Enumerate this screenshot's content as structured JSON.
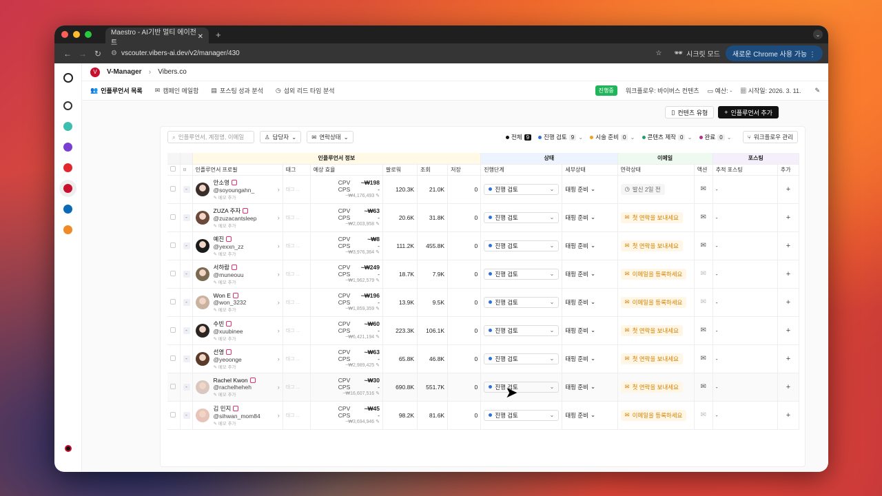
{
  "browser": {
    "tab_title": "Maestro - AI기반 멀티 에이전트",
    "url": "vscouter.vibers-ai.dev/v2/manager/430",
    "incognito": "시크릿 모드",
    "chrome_update": "새로운 Chrome 사용 가능"
  },
  "breadcrumb": {
    "app": "V-Manager",
    "org": "Vibers.co"
  },
  "subnav": {
    "tabs": [
      "인플루언서 목록",
      "캠페인 메일함",
      "포스팅 성과 분석",
      "섭외 리드 타임 분석"
    ],
    "status_badge": "진행중",
    "workflow": "워크플로우: 바이버스 컨텐츠",
    "budget": "예산: -",
    "start": "시작일: 2026. 3. 11."
  },
  "actions": {
    "content_type": "컨텐츠 유형",
    "add_influencer": "인플루언서 추가"
  },
  "filters": {
    "search_placeholder": "인플루언서, 계정명, 이메일",
    "owner": "담당자",
    "contact_status": "연락상태",
    "workflow_manage": "워크플로우 관리"
  },
  "stats": [
    {
      "label": "전체",
      "count": "9",
      "color": "#111111"
    },
    {
      "label": "진행 검토",
      "count": "9",
      "color": "#2f6fdc"
    },
    {
      "label": "시술 준비",
      "count": "0",
      "color": "#f0a020"
    },
    {
      "label": "콘텐츠 제작",
      "count": "0",
      "color": "#22a06b"
    },
    {
      "label": "완료",
      "count": "0",
      "color": "#b0338f"
    }
  ],
  "table": {
    "groups": [
      "인플루언서 정보",
      "상태",
      "이메일",
      "포스팅"
    ],
    "headers": [
      "인플루언서 프로필",
      "태그",
      "예상 효율",
      "팔로워",
      "조회",
      "저장",
      "진행단계",
      "세부상태",
      "연락상태",
      "액션",
      "추적 포스팅",
      "추가"
    ],
    "rows": [
      {
        "name": "안소영",
        "handle": "@soyoungahn_",
        "memo": "메모 추가",
        "cpv": "~₩198",
        "cps": "-",
        "total": "~₩4,176,493",
        "followers": "120.3K",
        "views": "21.0K",
        "saves": "0",
        "stage": "진행 검토",
        "sub": "태핑 준비",
        "contact": "발신 2일 전",
        "contact_kind": "grey",
        "avatar": "#3a2e2a",
        "tracked": "-"
      },
      {
        "name": "ZUZA 주자",
        "handle": "@zuzacantsleep",
        "memo": "메모 추가",
        "cpv": "~₩63",
        "cps": "-",
        "total": "~₩2,003,958",
        "followers": "20.6K",
        "views": "31.8K",
        "saves": "0",
        "stage": "진행 검토",
        "sub": "태핑 준비",
        "contact": "첫 연락을 보내세요",
        "contact_kind": "orange",
        "avatar": "#6b4a3a",
        "tracked": "-"
      },
      {
        "name": "예진",
        "handle": "@yexxn_zz",
        "memo": "메모 추가",
        "cpv": "~₩8",
        "cps": "-",
        "total": "~₩3,976,364",
        "followers": "111.2K",
        "views": "455.8K",
        "saves": "0",
        "stage": "진행 검토",
        "sub": "태핑 준비",
        "contact": "첫 연락을 보내세요",
        "contact_kind": "orange",
        "avatar": "#1b1b1b",
        "tracked": "-"
      },
      {
        "name": "서하람",
        "handle": "@muneouu",
        "memo": "메모 추가",
        "cpv": "~₩249",
        "cps": "-",
        "total": "~₩1,962,579",
        "followers": "18.7K",
        "views": "7.9K",
        "saves": "0",
        "stage": "진행 검토",
        "sub": "태핑 준비",
        "contact": "이메일을 등록하세요",
        "contact_kind": "orange",
        "avatar": "#7a6a50",
        "tracked": "-"
      },
      {
        "name": "Won E",
        "handle": "@won_3232",
        "memo": "메모 추가",
        "cpv": "~₩196",
        "cps": "-",
        "total": "~₩1,859,359",
        "followers": "13.9K",
        "views": "9.5K",
        "saves": "0",
        "stage": "진행 검토",
        "sub": "태핑 준비",
        "contact": "이메일을 등록하세요",
        "contact_kind": "orange",
        "avatar": "#c9b2a0",
        "tracked": "-"
      },
      {
        "name": "수빈",
        "handle": "@xuubinee",
        "memo": "메모 추가",
        "cpv": "~₩60",
        "cps": "-",
        "total": "~₩6,421,194",
        "followers": "223.3K",
        "views": "106.1K",
        "saves": "0",
        "stage": "진행 검토",
        "sub": "태핑 준비",
        "contact": "첫 연락을 보내세요",
        "contact_kind": "orange",
        "avatar": "#2a2422",
        "tracked": "-"
      },
      {
        "name": "선영",
        "handle": "@yeoonge",
        "memo": "메모 추가",
        "cpv": "~₩63",
        "cps": "-",
        "total": "~₩2,989,425",
        "followers": "65.8K",
        "views": "46.8K",
        "saves": "0",
        "stage": "진행 검토",
        "sub": "태핑 준비",
        "contact": "첫 연락을 보내세요",
        "contact_kind": "orange",
        "avatar": "#5a3a2a",
        "tracked": "-"
      },
      {
        "name": "Rachel Kwon",
        "handle": "@rachelheheh",
        "memo": "메모 추가",
        "cpv": "~₩30",
        "cps": "-",
        "total": "~₩16,607,516",
        "followers": "690.8K",
        "views": "551.7K",
        "saves": "0",
        "stage": "진행 검토",
        "sub": "태핑 준비",
        "contact": "첫 연락을 보내세요",
        "contact_kind": "orange",
        "avatar": "#d8c8c0",
        "tracked": "-"
      },
      {
        "name": "김 민지",
        "handle": "@sihwan_mom84",
        "memo": "메모 추가",
        "cpv": "~₩45",
        "cps": "-",
        "total": "~₩3,694,946",
        "followers": "98.2K",
        "views": "81.6K",
        "saves": "0",
        "stage": "진행 검토",
        "sub": "태핑 준비",
        "contact": "이메일을 등록하세요",
        "contact_kind": "orange",
        "avatar": "#e8c4b8",
        "tracked": "-"
      }
    ],
    "tag_placeholder": "태그 ...",
    "cpv_label": "CPV",
    "cps_label": "CPS"
  },
  "colors": {
    "brand": "#c8102e",
    "accent_blue": "#2f6fdc",
    "warn": "#d18000",
    "badge": "#20b55a"
  },
  "icons": {
    "rail": [
      "maestro-logo-icon",
      "app-icon-1",
      "app-icon-2",
      "app-icon-3",
      "app-icon-4",
      "app-icon-5",
      "app-icon-6",
      "app-icon-7"
    ]
  }
}
